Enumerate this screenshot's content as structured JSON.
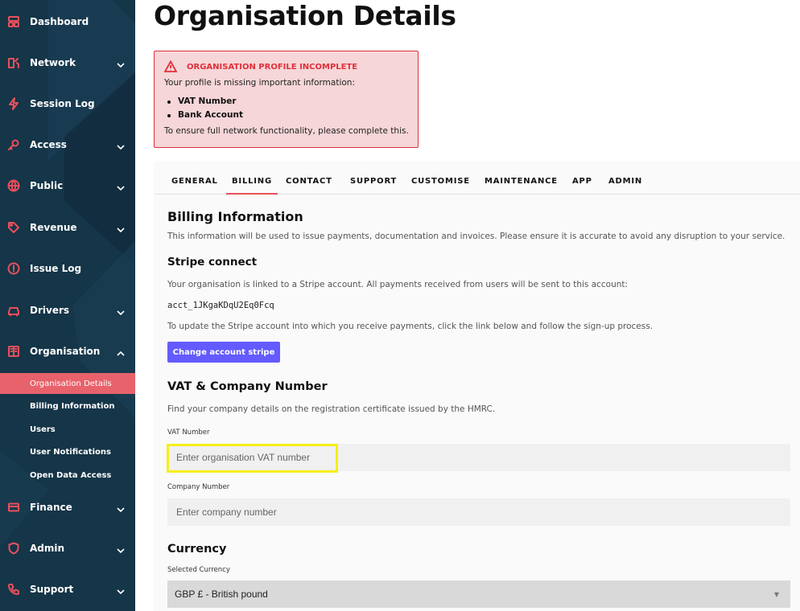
{
  "sidebar": {
    "items": [
      {
        "label": "Dashboard",
        "icon": "dashboard-icon"
      },
      {
        "label": "Network",
        "icon": "network-icon"
      },
      {
        "label": "Session Log",
        "icon": "lightning-icon"
      },
      {
        "label": "Access",
        "icon": "key-icon"
      },
      {
        "label": "Public",
        "icon": "globe-icon"
      },
      {
        "label": "Revenue",
        "icon": "tag-icon"
      },
      {
        "label": "Issue Log",
        "icon": "alert-circle-icon"
      },
      {
        "label": "Drivers",
        "icon": "car-icon"
      },
      {
        "label": "Organisation",
        "icon": "building-icon"
      },
      {
        "label": "Finance",
        "icon": "card-icon"
      },
      {
        "label": "Admin",
        "icon": "shield-icon"
      },
      {
        "label": "Support",
        "icon": "phone-icon"
      }
    ],
    "sub_items": [
      {
        "label": "Organisation Details"
      },
      {
        "label": "Billing Information"
      },
      {
        "label": "Users"
      },
      {
        "label": "User Notifications"
      },
      {
        "label": "Open Data Access"
      }
    ]
  },
  "page": {
    "title": "Organisation Details"
  },
  "alert": {
    "title": "ORGANISATION PROFILE INCOMPLETE",
    "intro": "Your profile is missing important information:",
    "items": [
      "VAT Number",
      "Bank Account"
    ],
    "footer": "To ensure full network functionality, please complete this."
  },
  "tabs": [
    {
      "label": "GENERAL"
    },
    {
      "label": "BILLING"
    },
    {
      "label": "CONTACT"
    },
    {
      "label": "SUPPORT"
    },
    {
      "label": "CUSTOMISE"
    },
    {
      "label": "MAINTENANCE"
    },
    {
      "label": "APP"
    },
    {
      "label": "ADMIN"
    }
  ],
  "billing": {
    "title": "Billing Information",
    "description": "This information will be used to issue payments, documentation and invoices. Please ensure it is accurate to avoid any disruption to your service.",
    "stripe": {
      "title": "Stripe connect",
      "linked_text": "Your organisation is linked to a Stripe account. All payments received from users will be sent to this account:",
      "account_id": "acct_1JKgaKDqU2Eq0Fcq",
      "update_text": "To update the Stripe account into which you receive payments, click the link below and follow the sign-up process.",
      "button_label": "Change account stripe"
    },
    "vat": {
      "title": "VAT & Company Number",
      "description": "Find your company details on the registration certificate issued by the HMRC.",
      "vat_label": "VAT Number",
      "vat_placeholder": "Enter organisation VAT number",
      "company_label": "Company Number",
      "company_placeholder": "Enter company number"
    },
    "currency": {
      "title": "Currency",
      "label": "Selected Currency",
      "value": "GBP £ - British pound"
    }
  },
  "colors": {
    "sidebar_bg": "#153548",
    "accent": "#e8505b",
    "alert_bg": "#f6d6d8",
    "alert_border": "#e0303b",
    "stripe": "#635bff",
    "highlight": "#f5ef1a"
  }
}
